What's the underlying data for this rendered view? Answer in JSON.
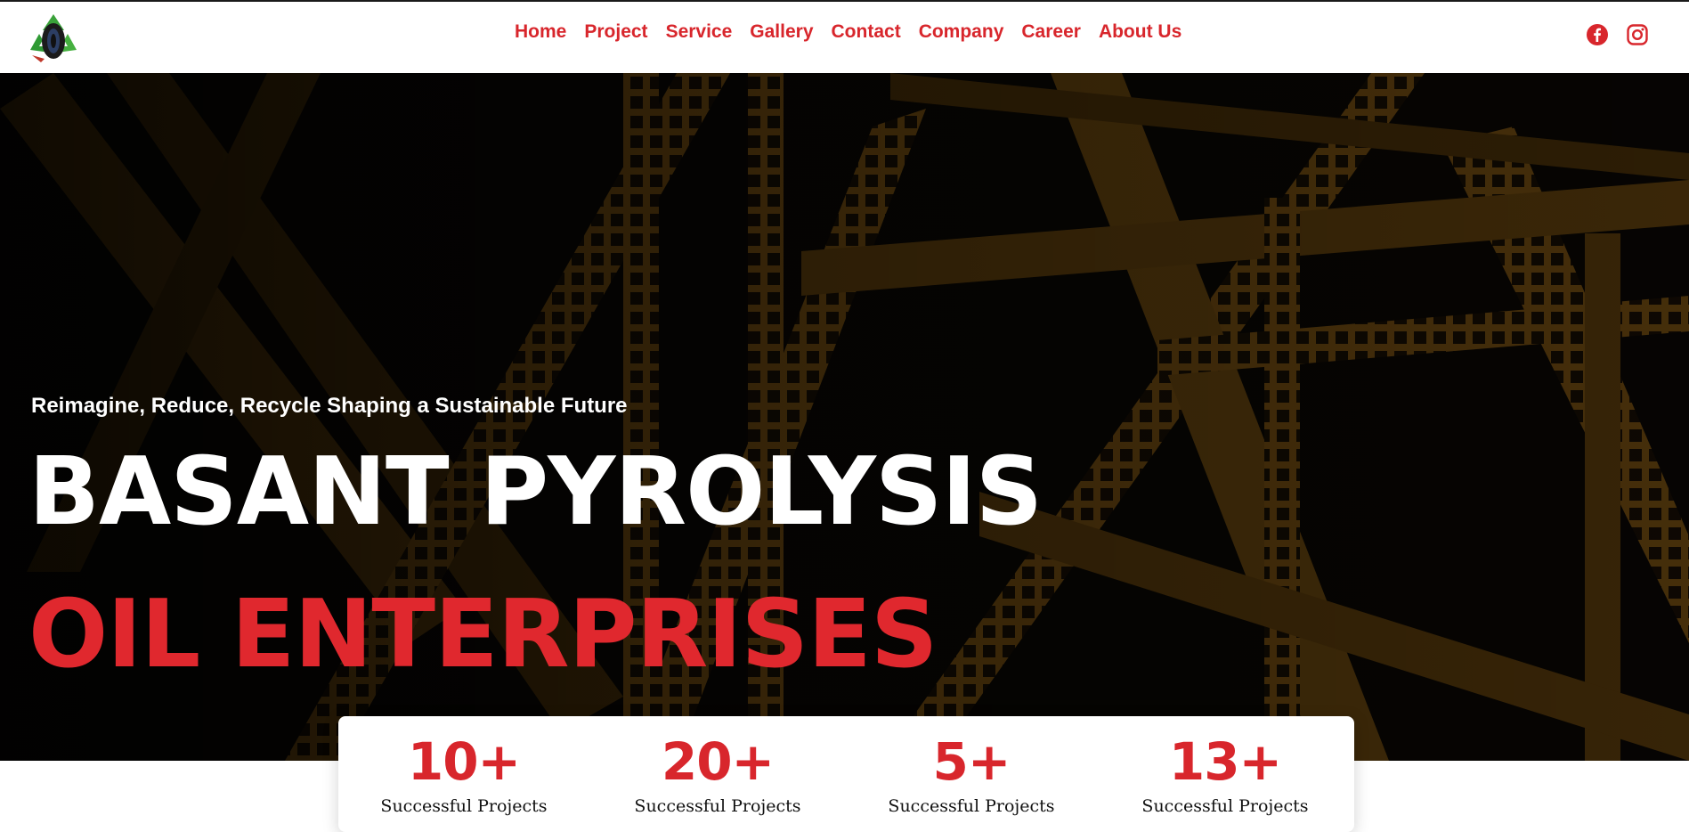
{
  "nav": {
    "items": [
      "Home",
      "Project",
      "Service",
      "Gallery",
      "Contact",
      "Company",
      "Career",
      "About Us"
    ]
  },
  "social": {
    "facebook": "facebook-icon",
    "instagram": "instagram-icon"
  },
  "hero": {
    "tagline": "Reimagine, Reduce, Recycle Shaping a Sustainable Future",
    "title_line1": "BASANT PYROLYSIS",
    "title_line2": "OIL ENTERPRISES"
  },
  "stats": [
    {
      "value": "10+",
      "label": "Successful Projects"
    },
    {
      "value": "20+",
      "label": "Successful Projects"
    },
    {
      "value": "5+",
      "label": "Successful Projects"
    },
    {
      "value": "13+",
      "label": "Successful Projects"
    }
  ],
  "colors": {
    "accent": "#d8262c",
    "hero_bg": "#050403",
    "steel": "#6b4a12"
  }
}
